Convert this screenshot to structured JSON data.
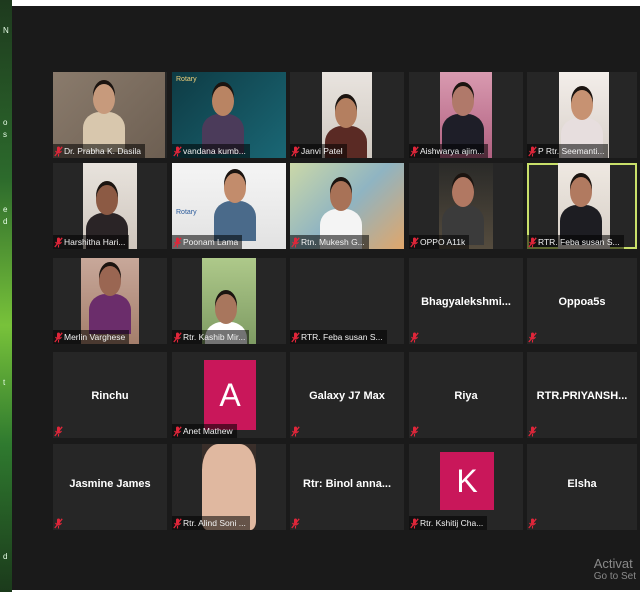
{
  "watermark": {
    "title": "Activat",
    "subtitle": "Go to Set"
  },
  "left_strip": [
    "N",
    "o",
    "s",
    "e",
    "d",
    "t",
    "d"
  ],
  "tiles": [
    {
      "name": "Dr. Prabha K. Dasila",
      "kind": "video"
    },
    {
      "name": "vandana kumb...",
      "kind": "video",
      "banner_text": "Rotary"
    },
    {
      "name": "Janvi Patel",
      "kind": "video"
    },
    {
      "name": "Aishwarya ajim...",
      "kind": "video"
    },
    {
      "name": "P Rtr. Seemanti...",
      "kind": "video"
    },
    {
      "name": "Harshitha Hari...",
      "kind": "video"
    },
    {
      "name": "Poonam Lama",
      "kind": "video",
      "banner_text": "Rotary"
    },
    {
      "name": "Rtn. Mukesh G...",
      "kind": "video"
    },
    {
      "name": "OPPO A11k",
      "kind": "video"
    },
    {
      "name": "RTR. Feba susan S...",
      "kind": "video",
      "active": true
    },
    {
      "name": "Merlin Varghese",
      "kind": "video"
    },
    {
      "name": "Rtr. Kashib Mir...",
      "kind": "video"
    },
    {
      "name": "RTR. Feba susan S...",
      "kind": "empty"
    },
    {
      "display": "Bhagyalekshmi...",
      "kind": "text"
    },
    {
      "display": "Oppoa5s",
      "kind": "text"
    },
    {
      "display": "Rinchu",
      "kind": "text"
    },
    {
      "name": "Anet Mathew",
      "kind": "avatar",
      "initial": "A"
    },
    {
      "display": "Galaxy J7 Max",
      "kind": "text"
    },
    {
      "display": "Riya",
      "kind": "text"
    },
    {
      "display": "RTR.PRIYANSH...",
      "kind": "text"
    },
    {
      "display": "Jasmine James",
      "kind": "text"
    },
    {
      "name": "Rtr. Alind Soni ...",
      "kind": "video"
    },
    {
      "display": "Rtr: Binol anna...",
      "kind": "text"
    },
    {
      "name": "Rtr. Kshitij Cha...",
      "kind": "avatar",
      "initial": "K"
    },
    {
      "display": "Elsha",
      "kind": "text"
    }
  ],
  "colors": {
    "background": "#1a1a1a",
    "tile": "#262626",
    "active_border": "#c9e06a",
    "avatar": "#c9175a",
    "muted_icon": "#e0263a"
  }
}
